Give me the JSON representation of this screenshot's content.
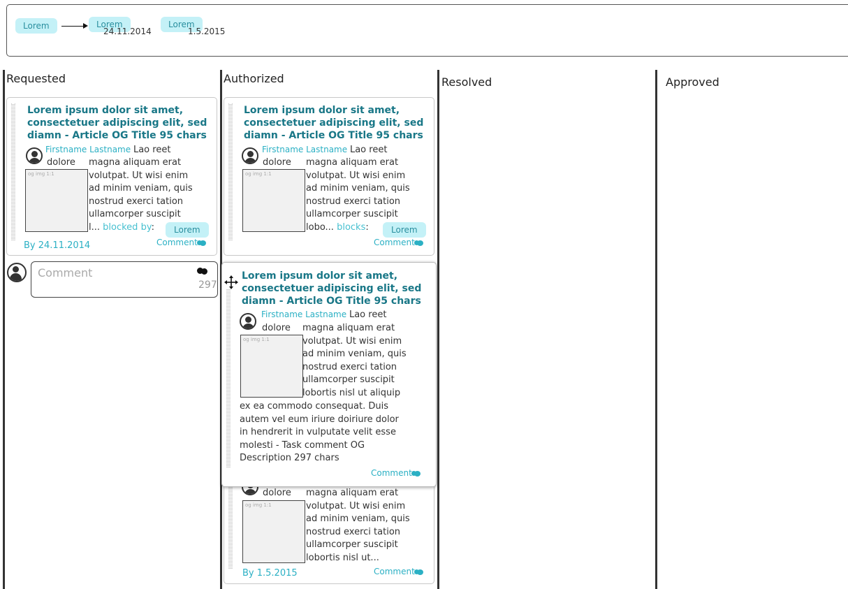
{
  "timeline": {
    "chips": [
      "Lorem",
      "Lorem",
      "Lorem"
    ],
    "dates": [
      "24.11.2014",
      "1.5.2015"
    ]
  },
  "columns": [
    "Requested",
    "Authorized",
    "Resolved",
    "Approved"
  ],
  "card": {
    "title_line1": "Lorem ipsum dolor sit amet,",
    "title_line2": "consectetuer adipiscing elit, sed",
    "title_line3": "diamn - Article OG Title 95 chars",
    "author": "Firstname Lastname",
    "lao_reet": "Lao reet",
    "dolore": "dolore",
    "img_label": "og img 1:1",
    "lines": [
      "magna aliquam erat",
      "volutpat. Ut wisi enim",
      "ad minim veniam, quis",
      "nostrud exerci tation",
      "ullamcorper suscipit",
      "lobortis nisl ut aliquip"
    ],
    "comment_label": "Comment"
  },
  "requested_card": {
    "trunc": "l...",
    "blocked_by": "blocked by",
    "chip": "Lorem",
    "by_date": "By 24.11.2014"
  },
  "authorized_card1": {
    "trunc": "lobo...",
    "blocks": "blocks",
    "chip": "Lorem"
  },
  "floating_card": {
    "extra_lines": [
      "ex ea commodo consequat. Duis",
      "autem vel eum iriure doiriure dolor",
      "in hendrerit in vulputate velit esse",
      "molesti - Task comment OG",
      "Description 297 chars"
    ]
  },
  "authorized_card2": {
    "last_line": "lobortis nisl ut...",
    "by_date": "By 1.5.2015"
  },
  "comment_box": {
    "placeholder": "Comment",
    "count": "297"
  }
}
